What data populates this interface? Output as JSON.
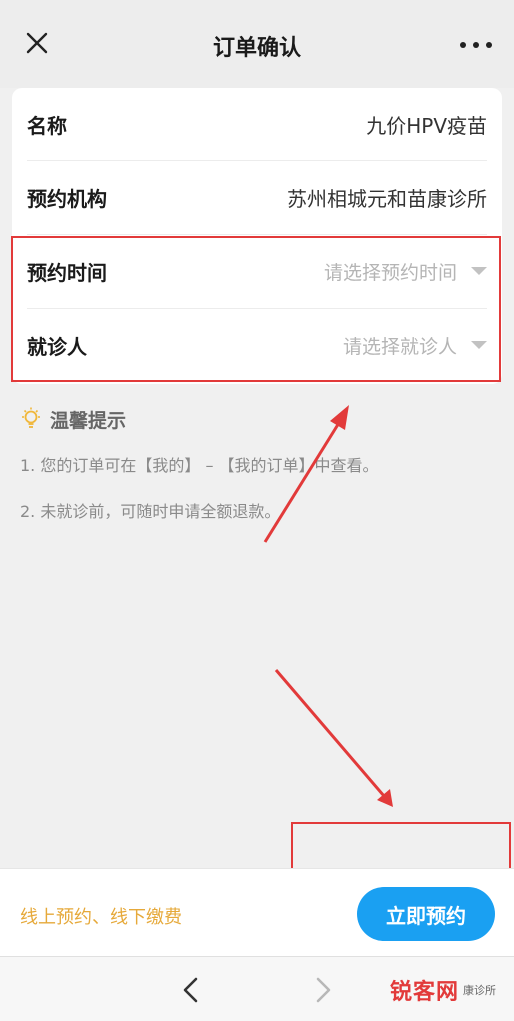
{
  "header": {
    "title": "订单确认"
  },
  "order": {
    "name_label": "名称",
    "name_value": "九价HPV疫苗",
    "org_label": "预约机构",
    "org_value": "苏州相城元和苗康诊所",
    "time_label": "预约时间",
    "time_placeholder": "请选择预约时间",
    "patient_label": "就诊人",
    "patient_placeholder": "请选择就诊人"
  },
  "tips": {
    "title": "温馨提示",
    "items": [
      "1. 您的订单可在【我的】 – 【我的订单】中查看。",
      "2. 未就诊前，可随时申请全额退款。"
    ]
  },
  "footer": {
    "note": "线上预约、线下缴费",
    "book_label": "立即预约"
  },
  "watermark": {
    "main": "锐客网",
    "sub": "康诊所"
  },
  "colors": {
    "accent": "#1aa0f2",
    "note": "#e6a93a",
    "highlight": "#e23a3a"
  },
  "icons": {
    "close": "close-icon",
    "more": "more-icon",
    "tip": "lightbulb-icon",
    "caret": "caret-down-icon",
    "back": "chevron-left-icon",
    "forward": "chevron-right-icon"
  }
}
